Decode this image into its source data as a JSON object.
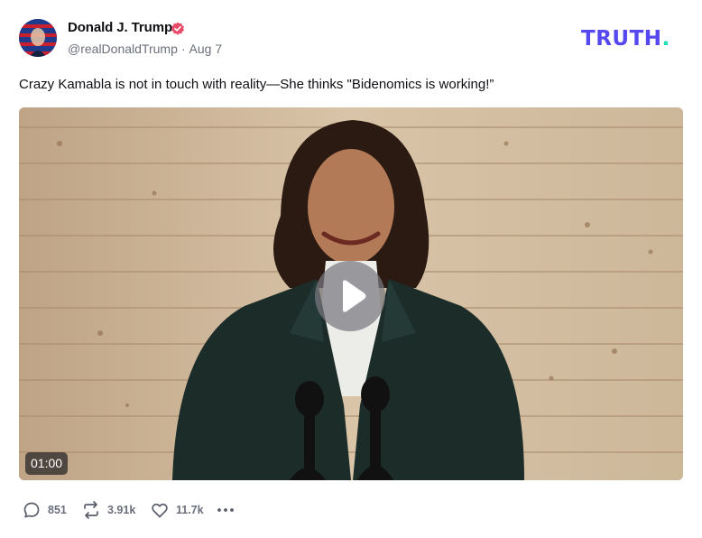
{
  "author": {
    "name": "Donald J. Trump",
    "handle": "@realDonaldTrump",
    "separator": "·",
    "date": "Aug 7",
    "verified": true
  },
  "brand": {
    "name": "TRUTH",
    "dot": ".",
    "color": "#5448ee",
    "dot_color": "#1ee0b6"
  },
  "post": {
    "text": "Crazy Kamabla is not in touch with reality—She thinks \"Bidenomics is working!”"
  },
  "video": {
    "duration": "01:00",
    "play_icon": "play-icon"
  },
  "actions": {
    "replies": "851",
    "retruths": "3.91k",
    "likes": "11.7k",
    "icons": [
      "reply-icon",
      "retruth-icon",
      "like-icon",
      "more-icon"
    ]
  }
}
